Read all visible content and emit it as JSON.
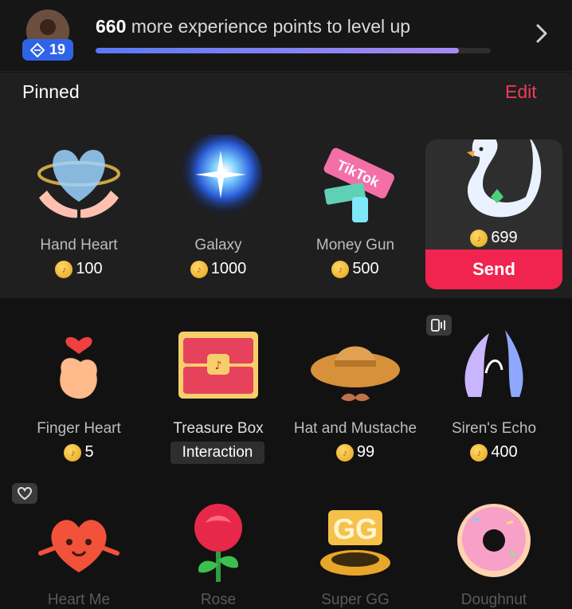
{
  "header": {
    "level": "19",
    "xp_amount": "660",
    "xp_text": "more experience points to level up",
    "progress_fraction": 0.92
  },
  "pinned": {
    "title": "Pinned",
    "edit_label": "Edit",
    "gifts": [
      {
        "name": "Hand Heart",
        "price": "100",
        "icon": "hand-heart-icon"
      },
      {
        "name": "Galaxy",
        "price": "1000",
        "icon": "galaxy-icon"
      },
      {
        "name": "Money Gun",
        "price": "500",
        "icon": "money-gun-icon",
        "art_text": "TikTok"
      },
      {
        "name": "Swan",
        "price": "699",
        "icon": "swan-icon",
        "selected": true,
        "send_label": "Send"
      }
    ]
  },
  "gifts": [
    {
      "name": "Finger Heart",
      "price": "5",
      "icon": "finger-heart-icon"
    },
    {
      "name": "Treasure Box",
      "tag": "Interaction",
      "icon": "treasure-box-icon"
    },
    {
      "name": "Hat and Mustache",
      "price": "99",
      "icon": "hat-mustache-icon"
    },
    {
      "name": "Siren's Echo",
      "price": "400",
      "icon": "siren-echo-icon",
      "badge": "audio-icon"
    },
    {
      "name": "Heart Me",
      "icon": "heart-me-icon",
      "badge": "heart-outline-icon"
    },
    {
      "name": "Rose",
      "icon": "rose-icon"
    },
    {
      "name": "Super GG",
      "icon": "super-gg-icon",
      "art_text": "GG"
    },
    {
      "name": "Doughnut",
      "icon": "doughnut-icon"
    }
  ],
  "colors": {
    "accent": "#f0244e",
    "level_badge": "#2f64e8",
    "coin": "#f5b92c"
  }
}
